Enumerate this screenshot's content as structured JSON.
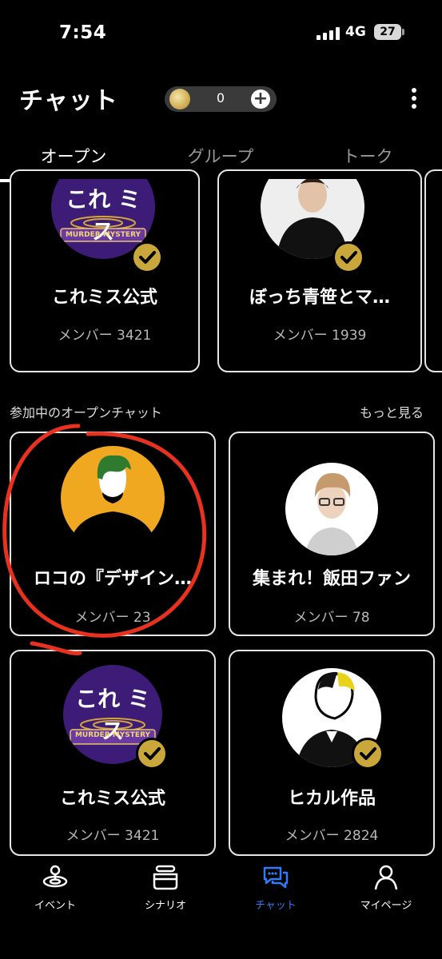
{
  "status_bar": {
    "time": "7:54",
    "network": "4G",
    "battery": "27"
  },
  "header": {
    "title": "チャット",
    "coin_count": "0"
  },
  "tabs": [
    {
      "label": "オープン",
      "active": true
    },
    {
      "label": "グループ",
      "active": false
    },
    {
      "label": "トーク",
      "active": false
    }
  ],
  "top_cards": [
    {
      "name": "これミス公式",
      "members": "メンバー 3421",
      "logo": "これ ミス",
      "logo_sub": "MURDER MYSTERY",
      "verified": true
    },
    {
      "name": "ぼっち青笹とマ…",
      "members": "メンバー 1939",
      "verified": true
    }
  ],
  "section": {
    "title": "参加中のオープンチャット",
    "more": "もっと見る"
  },
  "joined_cards": [
    {
      "name": "ロコの『デザイン…",
      "members": "メンバー 23",
      "verified": false
    },
    {
      "name": "集まれ！飯田ファン",
      "members": "メンバー 78",
      "verified": false
    },
    {
      "name": "これミス公式",
      "members": "メンバー 3421",
      "logo": "これ ミス",
      "logo_sub": "MURDER MYSTERY",
      "verified": true
    },
    {
      "name": "ヒカル作品",
      "members": "メンバー 2824",
      "verified": true
    }
  ],
  "bottom_nav": [
    {
      "label": "イベント",
      "icon": "event-icon",
      "active": false
    },
    {
      "label": "シナリオ",
      "icon": "scenario-icon",
      "active": false
    },
    {
      "label": "チャット",
      "icon": "chat-icon",
      "active": true
    },
    {
      "label": "マイページ",
      "icon": "person-icon",
      "active": false
    }
  ],
  "colors": {
    "accent": "#2f7cf6",
    "verified": "#c9a73a",
    "annotation": "#e8321f"
  }
}
